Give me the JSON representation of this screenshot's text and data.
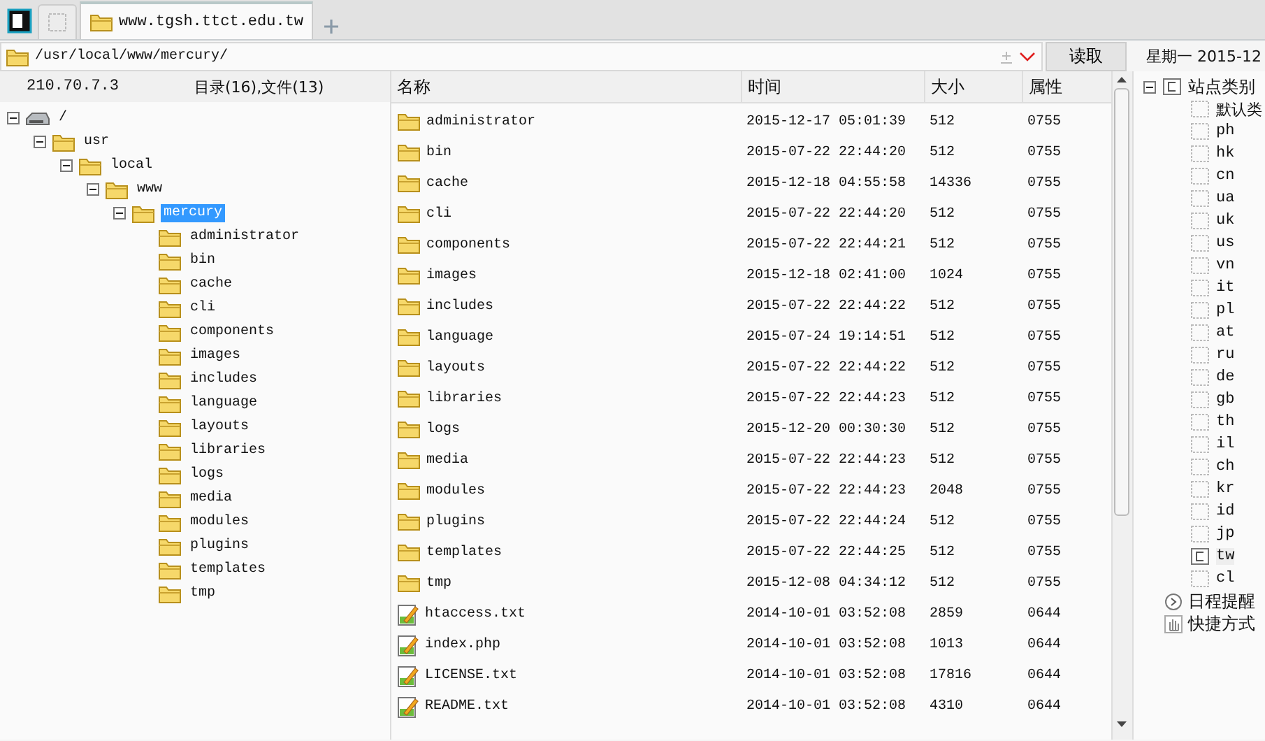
{
  "tabs": [
    {
      "label": "www.tgsh.ttct.edu.tw",
      "selected": true
    }
  ],
  "address": {
    "path": "/usr/local/www/mercury/",
    "read_button": "读取"
  },
  "date": "星期一 2015-12",
  "left_panel": {
    "host": "210.70.7.3",
    "summary": "目录(16),文件(13)",
    "tree": [
      {
        "label": "/",
        "kind": "drive",
        "expanded": true,
        "selected": false,
        "children": [
          {
            "label": "usr",
            "kind": "folder",
            "expanded": true,
            "selected": false,
            "children": [
              {
                "label": "local",
                "kind": "folder",
                "expanded": true,
                "selected": false,
                "children": [
                  {
                    "label": "www",
                    "kind": "folder",
                    "expanded": true,
                    "selected": false,
                    "children": [
                      {
                        "label": "mercury",
                        "kind": "folder",
                        "expanded": true,
                        "selected": true,
                        "children": [
                          {
                            "label": "administrator",
                            "kind": "folder",
                            "selected": false
                          },
                          {
                            "label": "bin",
                            "kind": "folder",
                            "selected": false
                          },
                          {
                            "label": "cache",
                            "kind": "folder",
                            "selected": false
                          },
                          {
                            "label": "cli",
                            "kind": "folder",
                            "selected": false
                          },
                          {
                            "label": "components",
                            "kind": "folder",
                            "selected": false
                          },
                          {
                            "label": "images",
                            "kind": "folder",
                            "selected": false
                          },
                          {
                            "label": "includes",
                            "kind": "folder",
                            "selected": false
                          },
                          {
                            "label": "language",
                            "kind": "folder",
                            "selected": false
                          },
                          {
                            "label": "layouts",
                            "kind": "folder",
                            "selected": false
                          },
                          {
                            "label": "libraries",
                            "kind": "folder",
                            "selected": false
                          },
                          {
                            "label": "logs",
                            "kind": "folder",
                            "selected": false
                          },
                          {
                            "label": "media",
                            "kind": "folder",
                            "selected": false
                          },
                          {
                            "label": "modules",
                            "kind": "folder",
                            "selected": false
                          },
                          {
                            "label": "plugins",
                            "kind": "folder",
                            "selected": false
                          },
                          {
                            "label": "templates",
                            "kind": "folder",
                            "selected": false
                          },
                          {
                            "label": "tmp",
                            "kind": "folder",
                            "selected": false
                          }
                        ]
                      }
                    ]
                  }
                ]
              }
            ]
          }
        ]
      }
    ]
  },
  "table": {
    "columns": [
      "名称",
      "时间",
      "大小",
      "属性"
    ],
    "rows": [
      {
        "kind": "folder",
        "name": "administrator",
        "time": "2015-12-17 05:01:39",
        "size": "512",
        "mode": "0755"
      },
      {
        "kind": "folder",
        "name": "bin",
        "time": "2015-07-22 22:44:20",
        "size": "512",
        "mode": "0755"
      },
      {
        "kind": "folder",
        "name": "cache",
        "time": "2015-12-18 04:55:58",
        "size": "14336",
        "mode": "0755"
      },
      {
        "kind": "folder",
        "name": "cli",
        "time": "2015-07-22 22:44:20",
        "size": "512",
        "mode": "0755"
      },
      {
        "kind": "folder",
        "name": "components",
        "time": "2015-07-22 22:44:21",
        "size": "512",
        "mode": "0755"
      },
      {
        "kind": "folder",
        "name": "images",
        "time": "2015-12-18 02:41:00",
        "size": "1024",
        "mode": "0755"
      },
      {
        "kind": "folder",
        "name": "includes",
        "time": "2015-07-22 22:44:22",
        "size": "512",
        "mode": "0755"
      },
      {
        "kind": "folder",
        "name": "language",
        "time": "2015-07-24 19:14:51",
        "size": "512",
        "mode": "0755"
      },
      {
        "kind": "folder",
        "name": "layouts",
        "time": "2015-07-22 22:44:22",
        "size": "512",
        "mode": "0755"
      },
      {
        "kind": "folder",
        "name": "libraries",
        "time": "2015-07-22 22:44:23",
        "size": "512",
        "mode": "0755"
      },
      {
        "kind": "folder",
        "name": "logs",
        "time": "2015-12-20 00:30:30",
        "size": "512",
        "mode": "0755"
      },
      {
        "kind": "folder",
        "name": "media",
        "time": "2015-07-22 22:44:23",
        "size": "512",
        "mode": "0755"
      },
      {
        "kind": "folder",
        "name": "modules",
        "time": "2015-07-22 22:44:23",
        "size": "2048",
        "mode": "0755"
      },
      {
        "kind": "folder",
        "name": "plugins",
        "time": "2015-07-22 22:44:24",
        "size": "512",
        "mode": "0755"
      },
      {
        "kind": "folder",
        "name": "templates",
        "time": "2015-07-22 22:44:25",
        "size": "512",
        "mode": "0755"
      },
      {
        "kind": "folder",
        "name": "tmp",
        "time": "2015-12-08 04:34:12",
        "size": "512",
        "mode": "0755"
      },
      {
        "kind": "file",
        "name": "htaccess.txt",
        "time": "2014-10-01 03:52:08",
        "size": "2859",
        "mode": "0644"
      },
      {
        "kind": "file",
        "name": "index.php",
        "time": "2014-10-01 03:52:08",
        "size": "1013",
        "mode": "0644"
      },
      {
        "kind": "file",
        "name": "LICENSE.txt",
        "time": "2014-10-01 03:52:08",
        "size": "17816",
        "mode": "0644"
      },
      {
        "kind": "file",
        "name": "README.txt",
        "time": "2014-10-01 03:52:08",
        "size": "4310",
        "mode": "0644"
      }
    ]
  },
  "categories": {
    "label": "站点类别",
    "expanded": true,
    "items": [
      {
        "label": "默认类",
        "selected": false
      },
      {
        "label": "ph",
        "selected": false
      },
      {
        "label": "hk",
        "selected": false
      },
      {
        "label": "cn",
        "selected": false
      },
      {
        "label": "ua",
        "selected": false
      },
      {
        "label": "uk",
        "selected": false
      },
      {
        "label": "us",
        "selected": false
      },
      {
        "label": "vn",
        "selected": false
      },
      {
        "label": "it",
        "selected": false
      },
      {
        "label": "pl",
        "selected": false
      },
      {
        "label": "at",
        "selected": false
      },
      {
        "label": "ru",
        "selected": false
      },
      {
        "label": "de",
        "selected": false
      },
      {
        "label": "gb",
        "selected": false
      },
      {
        "label": "th",
        "selected": false
      },
      {
        "label": "il",
        "selected": false
      },
      {
        "label": "ch",
        "selected": false
      },
      {
        "label": "kr",
        "selected": false
      },
      {
        "label": "id",
        "selected": false
      },
      {
        "label": "jp",
        "selected": false
      },
      {
        "label": "tw",
        "selected": true
      },
      {
        "label": "cl",
        "selected": false
      }
    ]
  },
  "extras": [
    {
      "kind": "schedule",
      "label": "日程提醒"
    },
    {
      "kind": "shortcut",
      "label": "快捷方式"
    }
  ]
}
